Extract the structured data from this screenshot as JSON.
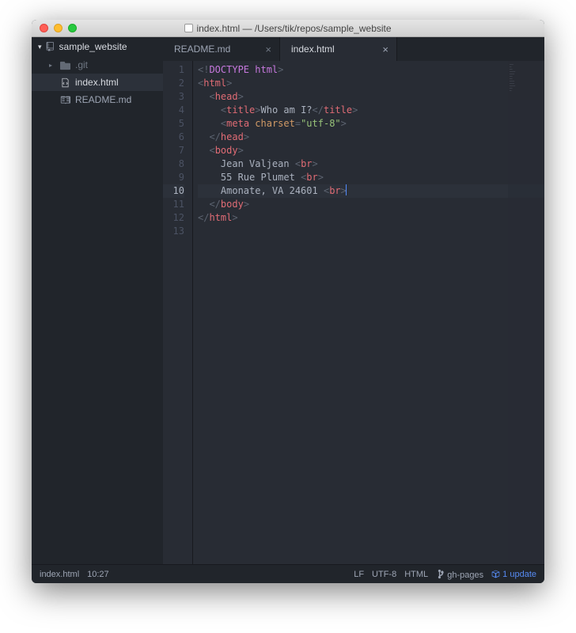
{
  "window_title": "index.html — /Users/tik/repos/sample_website",
  "project_root": "sample_website",
  "tree": {
    "folder": ".git",
    "files": [
      "index.html",
      "README.md"
    ],
    "active_file": "index.html"
  },
  "tabs": [
    {
      "label": "README.md",
      "active": false
    },
    {
      "label": "index.html",
      "active": true
    }
  ],
  "gutter_current": 10,
  "code_lines": {
    "l1": {
      "pre": "<!",
      "doctype": "DOCTYPE html",
      "post": ">"
    },
    "l2": {
      "open": "<",
      "tag": "html",
      "close": ">"
    },
    "l3": {
      "indent": "  ",
      "open": "<",
      "tag": "head",
      "close": ">"
    },
    "l4": {
      "indent": "    ",
      "open": "<",
      "tag": "title",
      "close": ">",
      "text": "Who am I?",
      "open2": "</",
      "tag2": "title",
      "close2": ">"
    },
    "l5": {
      "indent": "    ",
      "open": "<",
      "tag": "meta",
      "attr": " charset",
      "eq": "=",
      "val": "\"utf-8\"",
      "close": ">"
    },
    "l6": {
      "indent": "  ",
      "open": "</",
      "tag": "head",
      "close": ">"
    },
    "l7": {
      "indent": "  ",
      "open": "<",
      "tag": "body",
      "close": ">"
    },
    "l8": {
      "indent": "    ",
      "text": "Jean Valjean ",
      "open": "<",
      "tag": "br",
      "close": ">"
    },
    "l9": {
      "indent": "    ",
      "text": "55 Rue Plumet ",
      "open": "<",
      "tag": "br",
      "close": ">"
    },
    "l10": {
      "indent": "    ",
      "text": "Amonate, VA 24601 ",
      "open": "<",
      "tag": "br",
      "close": ">"
    },
    "l11": {
      "indent": "  ",
      "open": "</",
      "tag": "body",
      "close": ">"
    },
    "l12": {
      "open": "</",
      "tag": "html",
      "close": ">"
    }
  },
  "line_numbers": [
    "1",
    "2",
    "3",
    "4",
    "5",
    "6",
    "7",
    "8",
    "9",
    "10",
    "11",
    "12",
    "13"
  ],
  "statusbar": {
    "filename": "index.html",
    "cursor_pos": "10:27",
    "eol": "LF",
    "encoding": "UTF-8",
    "language": "HTML",
    "branch": "gh-pages",
    "updates": "1 update"
  }
}
